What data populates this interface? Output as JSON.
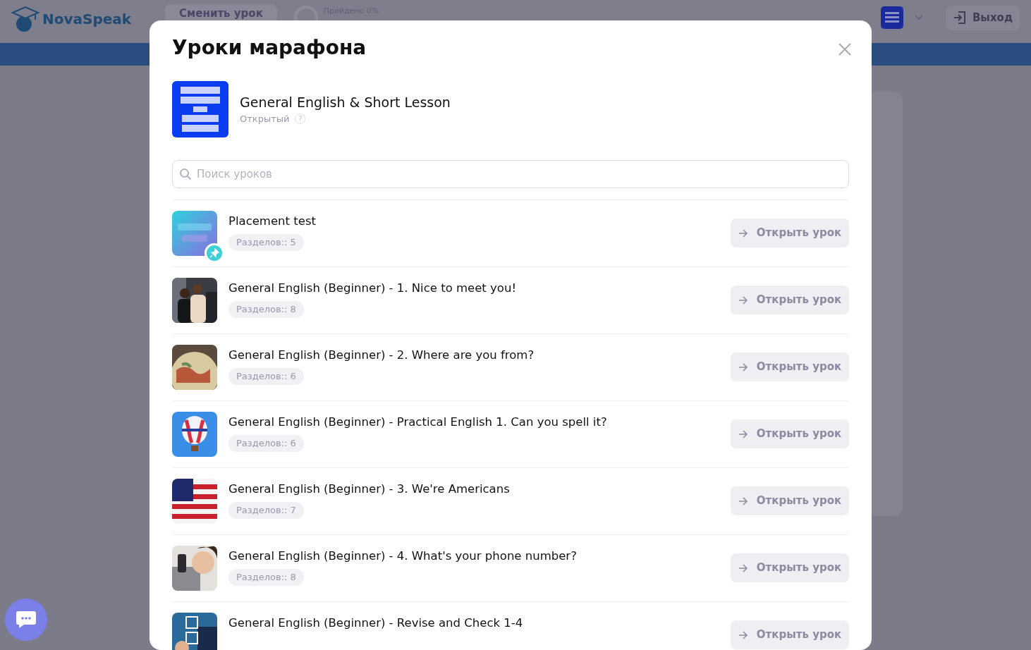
{
  "backdrop": {
    "logo": "NovaSpeak",
    "change_button": "Сменить урок",
    "progress": "Пройдено 0%",
    "logout_button": "Выход"
  },
  "modal": {
    "title": "Уроки марафона",
    "course": {
      "name": "General English & Short Lesson",
      "access": "Открытый",
      "help": "?"
    },
    "search": {
      "placeholder": "Поиск уроков"
    },
    "lessons": [
      {
        "title": "Placement test",
        "sections": "Разделов:: 5",
        "pinned": true,
        "button": "Открыть урок"
      },
      {
        "title": "General English (Beginner) - 1. Nice to meet you!",
        "sections": "Разделов:: 8",
        "pinned": false,
        "button": "Открыть урок"
      },
      {
        "title": "General English (Beginner) - 2. Where are you from?",
        "sections": "Разделов:: 6",
        "pinned": false,
        "button": "Открыть урок"
      },
      {
        "title": "General English (Beginner) - Practical English 1. Can you spell it?",
        "sections": "Разделов:: 6",
        "pinned": false,
        "button": "Открыть урок"
      },
      {
        "title": "General English (Beginner) - 3. We're Americans",
        "sections": "Разделов:: 7",
        "pinned": false,
        "button": "Открыть урок"
      },
      {
        "title": "General English (Beginner) - 4. What's your phone number?",
        "sections": "Разделов:: 8",
        "pinned": false,
        "button": "Открыть урок"
      },
      {
        "title": "General English (Beginner) - Revise and Check 1-4",
        "pinned": false,
        "button": "Открыть урок"
      }
    ]
  }
}
